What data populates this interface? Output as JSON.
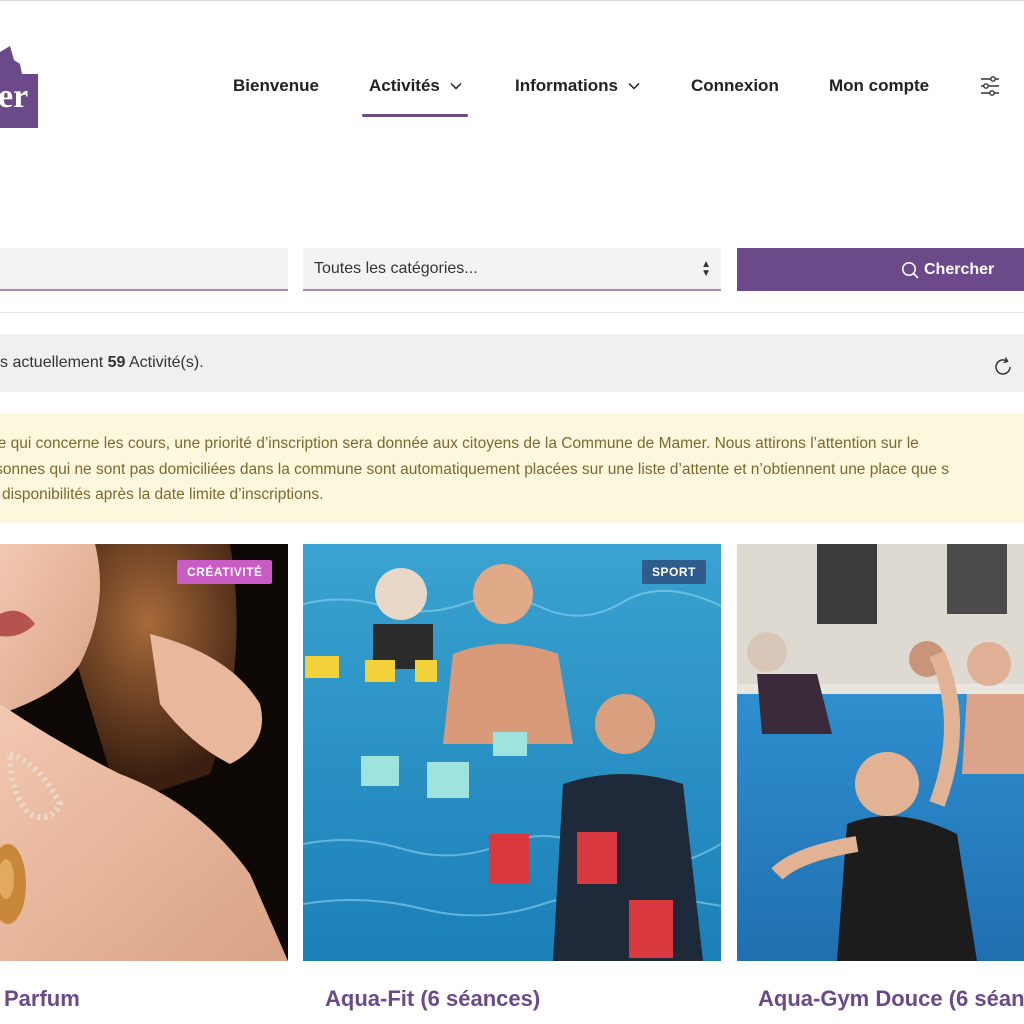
{
  "nav": {
    "items": [
      {
        "label": "Bienvenue",
        "has_dropdown": false
      },
      {
        "label": "Activités",
        "has_dropdown": true,
        "active": true
      },
      {
        "label": "Informations",
        "has_dropdown": true
      },
      {
        "label": "Connexion",
        "has_dropdown": false
      },
      {
        "label": "Mon compte",
        "has_dropdown": false
      }
    ],
    "logo_text": "er"
  },
  "search": {
    "keyword_placeholder": "",
    "category_value": "Toutes les catégories...",
    "button_label": "Chercher"
  },
  "count": {
    "prefix": "s actuellement ",
    "number": "59",
    "suffix": " Activité(s)."
  },
  "notice": {
    "line1": "ce qui concerne les cours, une priorité d’inscription sera donnée aux citoyens de la Commune de Mamer. Nous attirons l’attention sur le",
    "line2": "rsonnes qui ne sont pas domiciliées dans la commune sont automatiquement placées sur une liste d’attente et n’obtiennent une place que s",
    "line3": "s disponibilités après la date limite d’inscriptions."
  },
  "cards": [
    {
      "title": "Parfum",
      "badge": "CRÉATIVITÉ",
      "badge_color": "#c85bc4",
      "subtitle": ""
    },
    {
      "title": "Aqua-Fit (6 séances)",
      "badge": "SPORT",
      "badge_color": "#2f5c8c",
      "subtitle": ""
    },
    {
      "title": "Aqua-Gym Douce (6 séan",
      "badge": "",
      "badge_color": "",
      "subtitle": ""
    }
  ],
  "colors": {
    "accent": "#6c4a8a",
    "notice_bg": "#fdf7dd",
    "notice_text": "#7a6a2f"
  }
}
